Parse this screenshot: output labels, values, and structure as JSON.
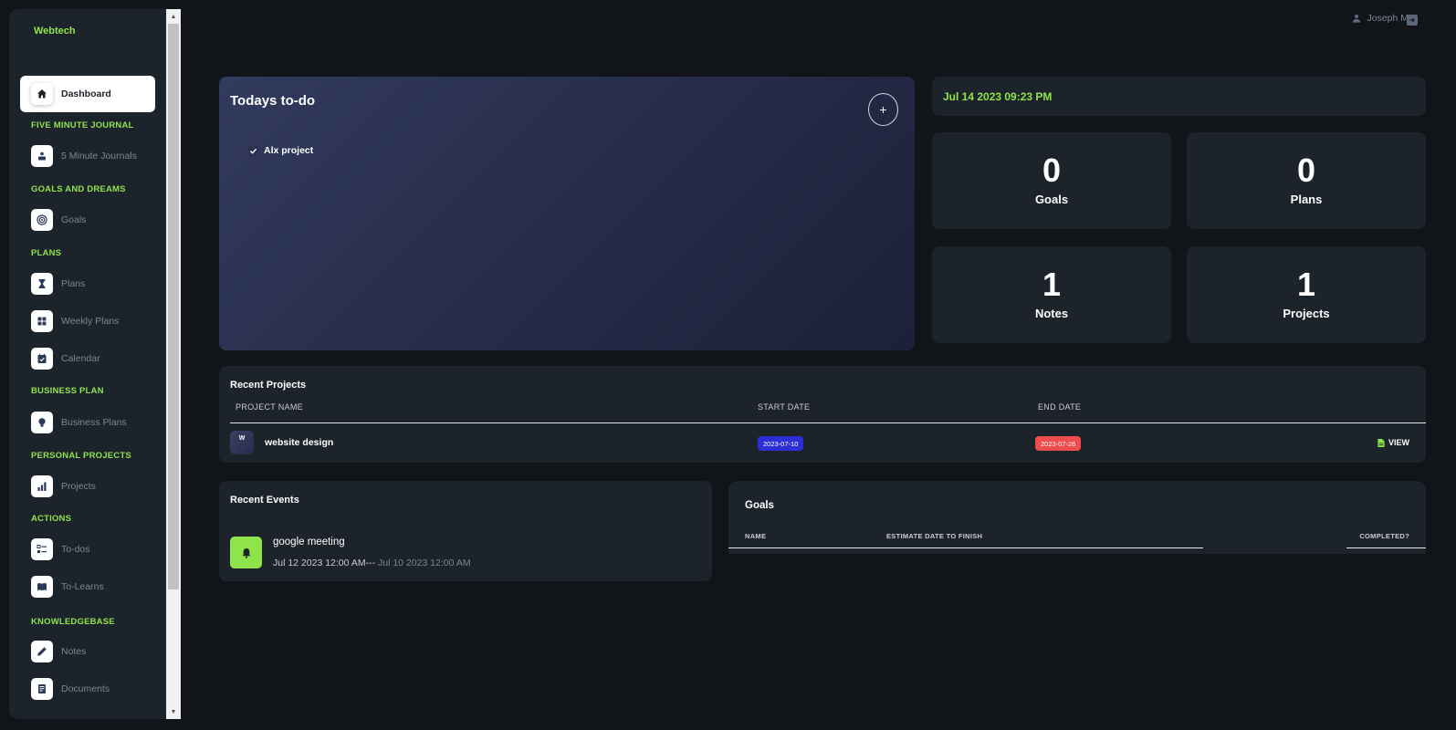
{
  "sidebar": {
    "brand": "Webtech",
    "active": {
      "label": "Dashboard",
      "icon": "home-icon"
    },
    "sections": [
      {
        "heading": "FIVE MINUTE JOURNAL",
        "items": [
          {
            "label": "5 Minute Journals",
            "icon": "journal-icon"
          }
        ]
      },
      {
        "heading": "GOALS AND DREAMS",
        "items": [
          {
            "label": "Goals",
            "icon": "target-icon"
          }
        ]
      },
      {
        "heading": "PLANS",
        "items": [
          {
            "label": "Plans",
            "icon": "hourglass-icon"
          },
          {
            "label": "Weekly Plans",
            "icon": "grid-icon"
          },
          {
            "label": "Calendar",
            "icon": "calendar-icon"
          }
        ]
      },
      {
        "heading": "BUSINESS PLAN",
        "items": [
          {
            "label": "Business Plans",
            "icon": "lightbulb-icon"
          }
        ]
      },
      {
        "heading": "PERSONAL PROJECTS",
        "items": [
          {
            "label": "Projects",
            "icon": "bar-chart-icon"
          }
        ]
      },
      {
        "heading": "ACTIONS",
        "items": [
          {
            "label": "To-dos",
            "icon": "checklist-icon"
          },
          {
            "label": "To-Learns",
            "icon": "book-icon"
          }
        ]
      },
      {
        "heading": "KNOWLEDGEBASE",
        "items": [
          {
            "label": "Notes",
            "icon": "pencil-icon"
          },
          {
            "label": "Documents",
            "icon": "document-icon"
          }
        ]
      }
    ]
  },
  "header": {
    "user_name": "Joseph M",
    "user_icon": "user-icon",
    "logout_icon": "logout-icon"
  },
  "todo": {
    "title": "Todays to-do",
    "add_label": "+",
    "items": [
      {
        "text": "Alx project",
        "checked": true
      }
    ]
  },
  "datetime": "Jul 14 2023 09:23 PM",
  "stats": [
    {
      "value": "0",
      "label": "Goals"
    },
    {
      "value": "0",
      "label": "Plans"
    },
    {
      "value": "1",
      "label": "Notes"
    },
    {
      "value": "1",
      "label": "Projects"
    }
  ],
  "recent_projects": {
    "title": "Recent Projects",
    "columns": [
      "PROJECT NAME",
      "START DATE",
      "END DATE"
    ],
    "rows": [
      {
        "avatar": "W",
        "name": "website design",
        "start": "2023-07-10",
        "end": "2023-07-26",
        "action": "VIEW"
      }
    ]
  },
  "recent_events": {
    "title": "Recent Events",
    "items": [
      {
        "title": "google meeting",
        "start": "Jul 12 2023 12:00 AM",
        "separator": "---",
        "end": "Jul 10 2023 12:00 AM"
      }
    ]
  },
  "goals_table": {
    "title": "Goals",
    "columns": [
      "NAME",
      "ESTIMATE DATE TO FINISH",
      "COMPLETED?"
    ]
  },
  "colors": {
    "accent": "#8fe34b",
    "background": "#111519",
    "card": "#1d232b",
    "start_badge": "#2c2fd6",
    "end_badge": "#ef4d4d"
  }
}
